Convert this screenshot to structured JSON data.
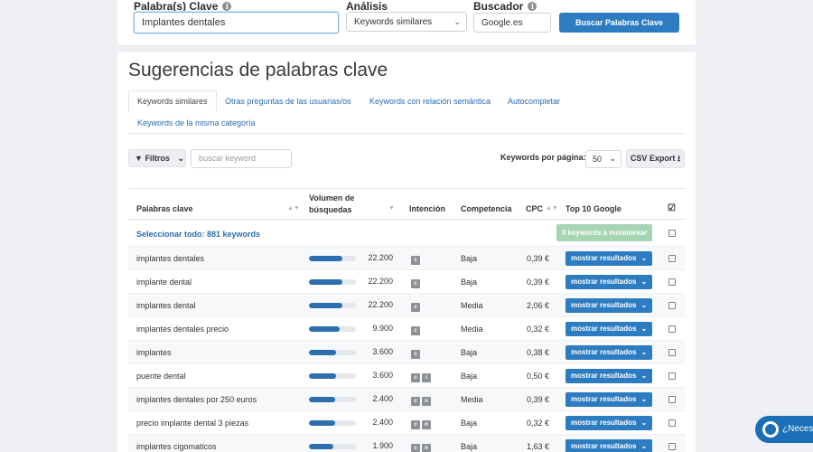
{
  "search": {
    "keyword_label": "Palabra(s) Clave",
    "keyword_value": "Implantes dentales",
    "analysis_label": "Análisis",
    "analysis_value": "Keywords similares",
    "engine_label": "Buscador",
    "engine_value": "Google.es",
    "button_label": "Buscar Palabras Clave"
  },
  "main": {
    "title": "Sugerencias de palabras clave",
    "tabs": [
      {
        "label": "Keywords similares",
        "active": true
      },
      {
        "label": "Otras preguntas de las usuarias/os"
      },
      {
        "label": "Keywords con relación semántica"
      },
      {
        "label": "Autocompletar"
      },
      {
        "label": "Keywords de la misma categoría"
      }
    ],
    "filters_label": "Filtros",
    "filter_placeholder": "buscar keyword",
    "per_page_label": "Keywords por página:",
    "per_page_value": "50",
    "csv_label": "CSV Export"
  },
  "table": {
    "headers": {
      "keyword": "Palabras clave",
      "volume_line1": "Volumen de",
      "volume_line2": "búsquedas",
      "intent": "Intención",
      "competition": "Competencia",
      "cpc": "CPC",
      "top10": "Top 10 Google"
    },
    "select_all": "Seleccionar todo: 881 keywords",
    "monitor_label": "0 keywords a monitorear",
    "show_results_label": "mostrar resultados",
    "rows": [
      {
        "keyword": "implantes dentales",
        "volume": "22.200",
        "volume_fraction": 0.72,
        "intent": [
          "c"
        ],
        "competition": "Baja",
        "cpc": "0,39 €"
      },
      {
        "keyword": "implante dental",
        "volume": "22.200",
        "volume_fraction": 0.72,
        "intent": [
          "c"
        ],
        "competition": "Baja",
        "cpc": "0,39 €"
      },
      {
        "keyword": "implantes dental",
        "volume": "22.200",
        "volume_fraction": 0.72,
        "intent": [
          "c"
        ],
        "competition": "Media",
        "cpc": "2,06 €"
      },
      {
        "keyword": "implantes dentales precio",
        "volume": "9.900",
        "volume_fraction": 0.65,
        "intent": [
          "c"
        ],
        "competition": "Media",
        "cpc": "0,32 €"
      },
      {
        "keyword": "implantes",
        "volume": "3.600",
        "volume_fraction": 0.58,
        "intent": [
          "c"
        ],
        "competition": "Baja",
        "cpc": "0,38 €"
      },
      {
        "keyword": "puente dental",
        "volume": "3.600",
        "volume_fraction": 0.58,
        "intent": [
          "c",
          "i"
        ],
        "competition": "Baja",
        "cpc": "0,50 €"
      },
      {
        "keyword": "implantes dentales por 250 euros",
        "volume": "2.400",
        "volume_fraction": 0.55,
        "intent": [
          "c",
          "n"
        ],
        "competition": "Media",
        "cpc": "0,39 €"
      },
      {
        "keyword": "precio implante dental 3 piezas",
        "volume": "2.400",
        "volume_fraction": 0.55,
        "intent": [
          "c",
          "n"
        ],
        "competition": "Baja",
        "cpc": "0,32 €"
      },
      {
        "keyword": "implantes cigomaticos",
        "volume": "1.900",
        "volume_fraction": 0.52,
        "intent": [
          "c",
          "n"
        ],
        "competition": "Baja",
        "cpc": "1,63 €"
      }
    ]
  },
  "help": {
    "label": "¿Necesit"
  }
}
